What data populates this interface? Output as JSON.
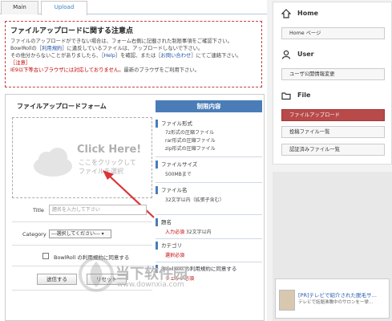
{
  "tabs": {
    "main": "Main",
    "upload": "Upload"
  },
  "notice": {
    "title": "ファイルアップロードに関する注意点",
    "line1": "ファイルのアップロードができない場合は、フォーム右側に記載された制限事項をご確認下さい。",
    "line2a": "BowlRollの［",
    "line2_link": "利用規約",
    "line2b": "］に違反しているファイルは、アップロードしないで下さい。",
    "line3a": "その他分からないことがありましたら、［",
    "line3_link1": "Help",
    "line3b": "］を確認、または［",
    "line3_link2": "お問い合わせ",
    "line3c": "］にてご連絡下さい。",
    "line4": "［注意］",
    "line5_red": "IE9以下等古いブラウザには対応しておりません。",
    "line5_rest": "最新のブラウザをご利用下さい。"
  },
  "form": {
    "title": "ファイルアップロードフォーム",
    "click_here": "Click Here!",
    "click_sub1": "ここをクリックして",
    "click_sub2": "ファイルを選択",
    "title_label": "Title",
    "title_placeholder": "題名を入力して下さい",
    "category_label": "Category",
    "category_selected": "---選択してください---",
    "agree_label": "BowlRoll の利用規約に同意する",
    "submit": "送信する",
    "reset": "リセット"
  },
  "rules": {
    "head": "制限内容",
    "format_head": "ファイル形式",
    "format1": "7z形式の圧縮ファイル",
    "format2": "rar形式の圧縮ファイル",
    "format3": "zip形式の圧縮ファイル",
    "size_head": "ファイルサイズ",
    "size_val": "500MBまで",
    "name_head": "ファイル名",
    "name_val": "32文字以内（拡張子含む）",
    "title_head": "題名",
    "title_req": "入力必須",
    "title_val": "32文字以内",
    "category_head": "カテゴリ",
    "category_req": "選択必須",
    "terms_head": "BowlRoll の利用規約に同意する",
    "terms_req": "チェック必須"
  },
  "sidebar": {
    "home": "Home",
    "home_btn": "Home ページ",
    "user": "User",
    "user_btn": "ユーザ公開情報変更",
    "file": "File",
    "file_btn1": "ファイルアップロード",
    "file_btn2": "投稿ファイル一覧",
    "file_btn3": "認証済みファイル一覧"
  },
  "ad": {
    "line1": "[PR]テレビで紹介された脱毛サ…",
    "line2": "テレビで話題沸騰中のサロンを一挙…"
  },
  "watermark": {
    "text": "当下软件园",
    "url": "www.downxia.com"
  },
  "colors": {
    "accent": "#4a7db8",
    "active": "#b84a4a",
    "notice_border": "#c04040"
  }
}
